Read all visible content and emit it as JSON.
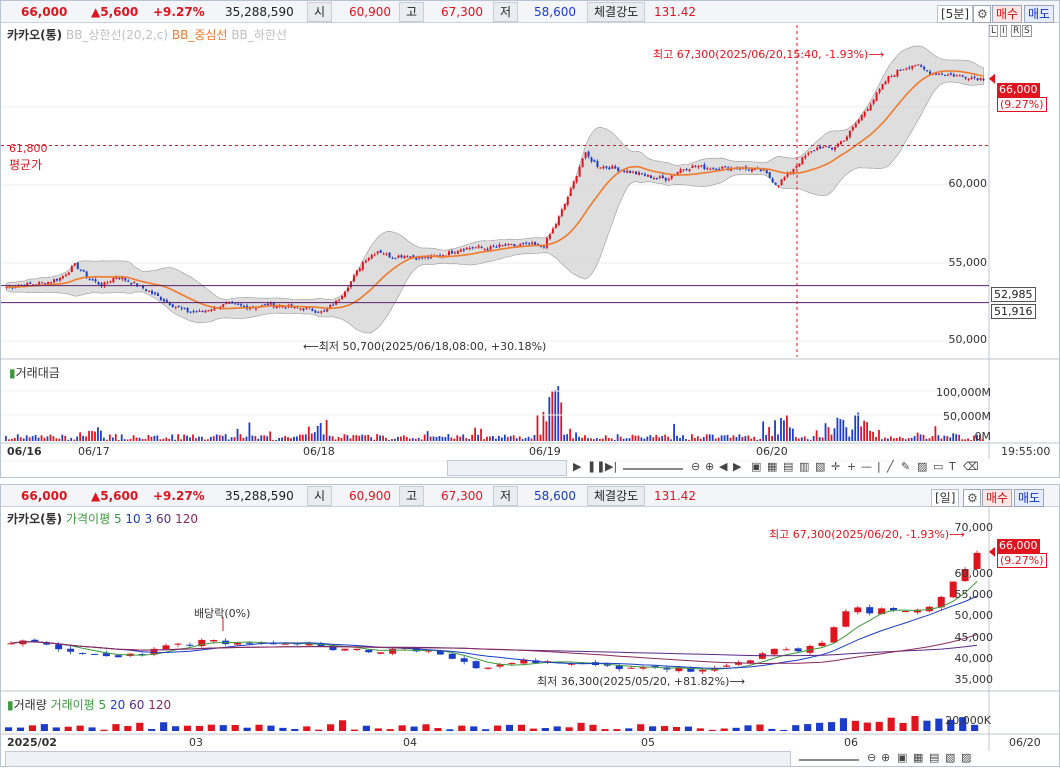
{
  "quote": {
    "price": "66,000",
    "change": "▲5,600",
    "change_pct": "+9.27%",
    "volume": "35,288,590",
    "open_label": "시",
    "open": "60,900",
    "high_label": "고",
    "high": "67,300",
    "low_label": "저",
    "low": "58,600",
    "strength_label": "체결강도",
    "strength": "131.42",
    "buy_label": "매수",
    "sell_label": "매도"
  },
  "top_chart": {
    "period": "[5분]",
    "legend": {
      "name": "카카오(통)",
      "bb_upper": "BB_상한선(20,2,c)",
      "bb_mid": "BB_중심선",
      "bb_lower": "BB_하한선"
    },
    "y_ticks": [
      "60,000",
      "55,000",
      "50,000"
    ],
    "price_tag": "66,000",
    "price_tag_pct": "(9.27%)",
    "level_tags": [
      "52,985",
      "51,916"
    ],
    "avg_value": "61,800",
    "avg_label": "평균가",
    "high_note": "최고 67,300(2025/06/20,15:40, -1.93%)⟶",
    "low_note": "⟵최저 50,700(2025/06/18,08:00, +30.18%)",
    "volume_label": "거래대금",
    "vol_ticks": [
      "100,000M",
      "50,000M",
      "0M"
    ],
    "x_labels": [
      "06/16",
      "06/17",
      "06/18",
      "06/19",
      "06/20"
    ],
    "time_label": "19:55:00",
    "corner_icons": [
      "L",
      "I",
      "R",
      "S"
    ]
  },
  "bottom_chart": {
    "period": "[일]",
    "legend": {
      "name": "카카오(통)",
      "ma_label": "가격이평 5",
      "ma2": "10",
      "ma3": "3",
      "ma4": "60",
      "ma5": "120"
    },
    "y_ticks": [
      "70,000",
      "65,000",
      "60,000",
      "55,000",
      "50,000",
      "45,000",
      "40,000",
      "35,000"
    ],
    "price_tag": "66,000",
    "price_tag_pct": "(9.27%)",
    "high_note": "최고 67,300(2025/06/20, -1.93%)⟶",
    "low_note": "최저 36,300(2025/05/20, +81.82%)⟶",
    "dividend_note": "배당락(0%)",
    "volume_label": "거래량",
    "vol_ma_label": "거래이평 5",
    "vol_ma2": "20",
    "vol_ma3": "60",
    "vol_ma4": "120",
    "vol_ticks": [
      "20,000K"
    ],
    "x_labels": [
      "2025/02",
      "03",
      "04",
      "05",
      "06"
    ],
    "date_label": "06/20"
  },
  "chart_data": [
    {
      "type": "candlestick",
      "title": "카카오(통) 5분",
      "x_labels": [
        "06/16",
        "06/17",
        "06/18",
        "06/19",
        "06/20"
      ],
      "ylim": [
        48500,
        69000
      ],
      "high": 67300,
      "low": 50700,
      "last": 66000,
      "reference_lines": [
        61800,
        52985,
        51916
      ],
      "path": [
        52900,
        53000,
        53100,
        53200,
        53500,
        54300,
        53400,
        53000,
        53600,
        53200,
        52800,
        52300,
        51800,
        51400,
        51300,
        51600,
        51800,
        51700,
        51600,
        51800,
        51700,
        51600,
        51500,
        51300,
        52000,
        53200,
        54600,
        55200,
        54800,
        54900,
        54700,
        54800,
        55000,
        55300,
        55400,
        55300,
        55500,
        55500,
        55600,
        55400,
        57000,
        59000,
        61300,
        60500,
        60400,
        60200,
        60000,
        59800,
        59700,
        60300,
        60500,
        60400,
        60400,
        60400,
        60300,
        60200,
        59300,
        60200,
        61100,
        61700,
        61600,
        62300,
        63500,
        64700,
        66000,
        66600,
        66900,
        66400,
        66300,
        66200,
        66100,
        66000
      ]
    },
    {
      "type": "candlestick",
      "title": "카카오(통) 일",
      "x_labels": [
        "2025/02",
        "03",
        "04",
        "05",
        "06"
      ],
      "ylim": [
        33500,
        72000
      ],
      "high": 67300,
      "low": 36300,
      "last": 66000,
      "path": [
        44500,
        44000,
        43800,
        42500,
        41800,
        41300,
        41000,
        41200,
        41500,
        42200,
        43300,
        44000,
        44500,
        44300,
        43800,
        43500,
        43700,
        44200,
        43900,
        43500,
        43200,
        42500,
        42200,
        42000,
        42300,
        42800,
        42400,
        41500,
        40000,
        38300,
        38700,
        39500,
        39800,
        39300,
        39200,
        39100,
        38900,
        38500,
        38300,
        38200,
        38500,
        38200,
        37800,
        37400,
        37500,
        38000,
        39000,
        40500,
        42500,
        43000,
        42500,
        43000,
        48000,
        53000,
        51000,
        52000,
        51500,
        52500,
        53000,
        56000,
        61000,
        66000
      ]
    }
  ]
}
